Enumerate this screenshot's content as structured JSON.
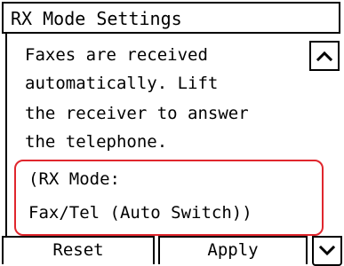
{
  "screen": {
    "title": "RX Mode Settings",
    "message_lines": [
      "Faxes are received",
      "automatically. Lift",
      "the receiver to answer",
      "the telephone."
    ],
    "mode_lines": [
      "(RX Mode:",
      "Fax/Tel (Auto Switch))"
    ],
    "highlight_color": "#e0262d"
  },
  "scroll": {
    "up_icon": "chevron-up-icon",
    "down_icon": "chevron-down-icon"
  },
  "footer": {
    "reset_label": "Reset",
    "apply_label": "Apply"
  }
}
